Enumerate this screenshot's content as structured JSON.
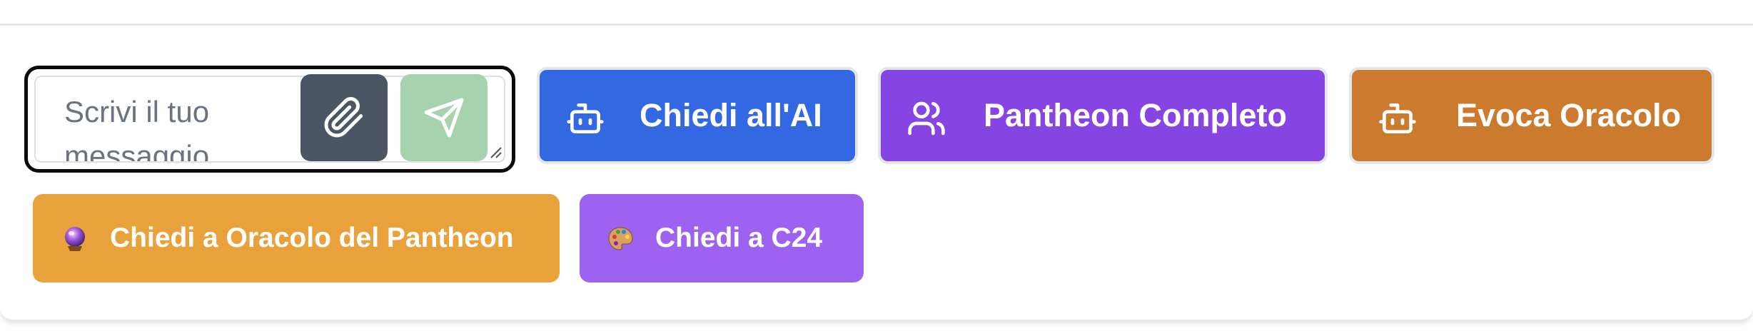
{
  "composer": {
    "placeholder": "Scrivi il tuo messaggio...",
    "attach_icon": "paperclip-icon",
    "send_icon": "send-icon",
    "send_color": "#a6d3ae",
    "attach_color": "#4b5563"
  },
  "actions": {
    "ask_ai": {
      "label": "Chiedi all'AI",
      "icon": "robot-icon",
      "color": "#3269e3"
    },
    "pantheon": {
      "label": "Pantheon Completo",
      "icon": "users-icon",
      "color": "#8645e2"
    },
    "evoca": {
      "label": "Evoca Oracolo",
      "icon": "robot-icon",
      "color": "#cc7b2e"
    },
    "ask_oracolo": {
      "label": "Chiedi a Oracolo del Pantheon",
      "icon": "crystal-ball-icon",
      "color": "#e9a23b"
    },
    "ask_c24": {
      "label": "Chiedi a C24",
      "icon": "palette-icon",
      "color": "#9d62ef"
    }
  }
}
